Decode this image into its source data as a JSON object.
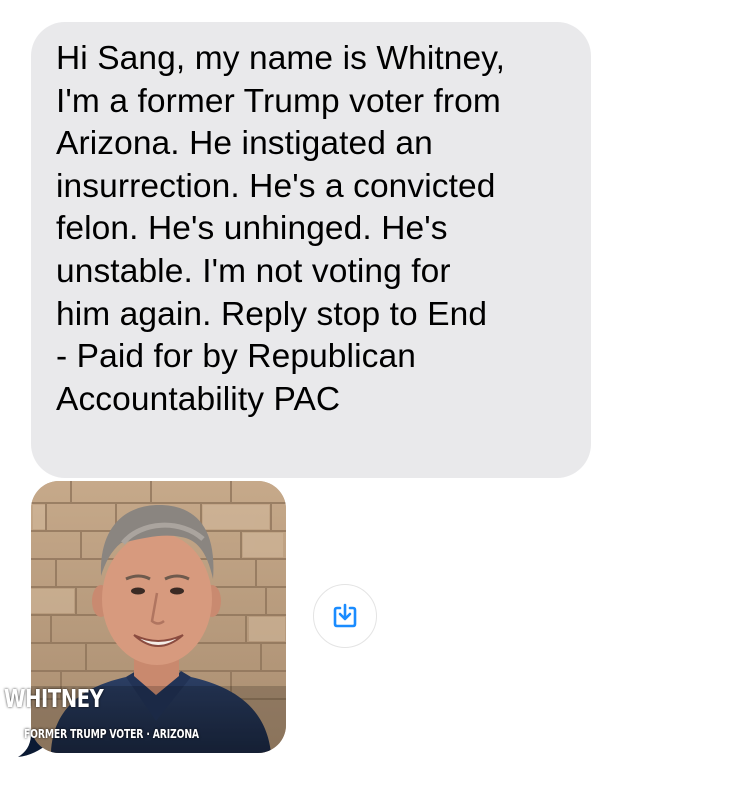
{
  "message": {
    "text": "Hi Sang, my name is Whitney, I'm a former Trump voter from Arizona. He instigated an insurrection. He's a convicted felon. He's unhinged. He's unstable. I'm not voting for him again. Reply stop to End - Paid for by Republican Accountability PAC",
    "lines": [
      "Hi Sang, my name is Whitney,",
      "I'm a former Trump voter from",
      "Arizona. He instigated an",
      "insurrection. He's a convicted",
      "felon. He's unhinged. He's",
      "unstable. I'm not voting for",
      "him again. Reply stop to End",
      "- Paid for by Republican",
      "Accountability PAC"
    ],
    "bubble_color": "#e9e9eb"
  },
  "image_attachment": {
    "caption_name": "WHITNEY",
    "caption_subtitle": "FORMER TRUMP VOTER · ARIZONA"
  },
  "save_button": {
    "icon": "download-icon",
    "color": "#1a8cff"
  }
}
